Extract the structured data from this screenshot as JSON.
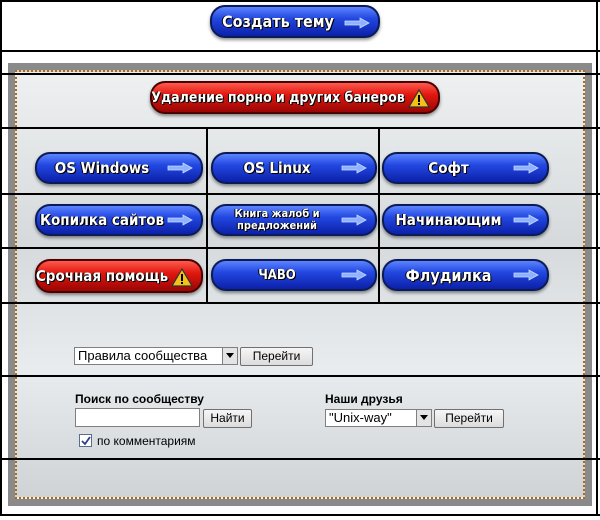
{
  "header": {
    "create_topic_label": "Создать тему"
  },
  "banner": {
    "remove_banners_label": "Удаление порно и других банеров"
  },
  "nav": {
    "os_windows": "OS Windows",
    "os_linux": "OS Linux",
    "soft": "Софт",
    "site_bank": "Копилка сайтов",
    "complaints_line1": "Книга жалоб и",
    "complaints_line2": "предложений",
    "beginners": "Начинающим",
    "urgent_help": "Срочная помощь",
    "faq": "ЧАВО",
    "flood": "Флудилка"
  },
  "rules": {
    "selected": "Правила сообщества",
    "go_label": "Перейти"
  },
  "search": {
    "title": "Поиск по сообществу",
    "value": "",
    "button_label": "Найти",
    "comments_checked": true,
    "comments_label": "по комментариям"
  },
  "friends": {
    "title": "Наши друзья",
    "selected": "\"Unix-way\"",
    "go_label": "Перейти"
  },
  "colors": {
    "button_blue": "#2247e0",
    "button_red": "#e01810",
    "frame_grey": "#8a8a8a",
    "dotted_border": "#b06a10"
  }
}
